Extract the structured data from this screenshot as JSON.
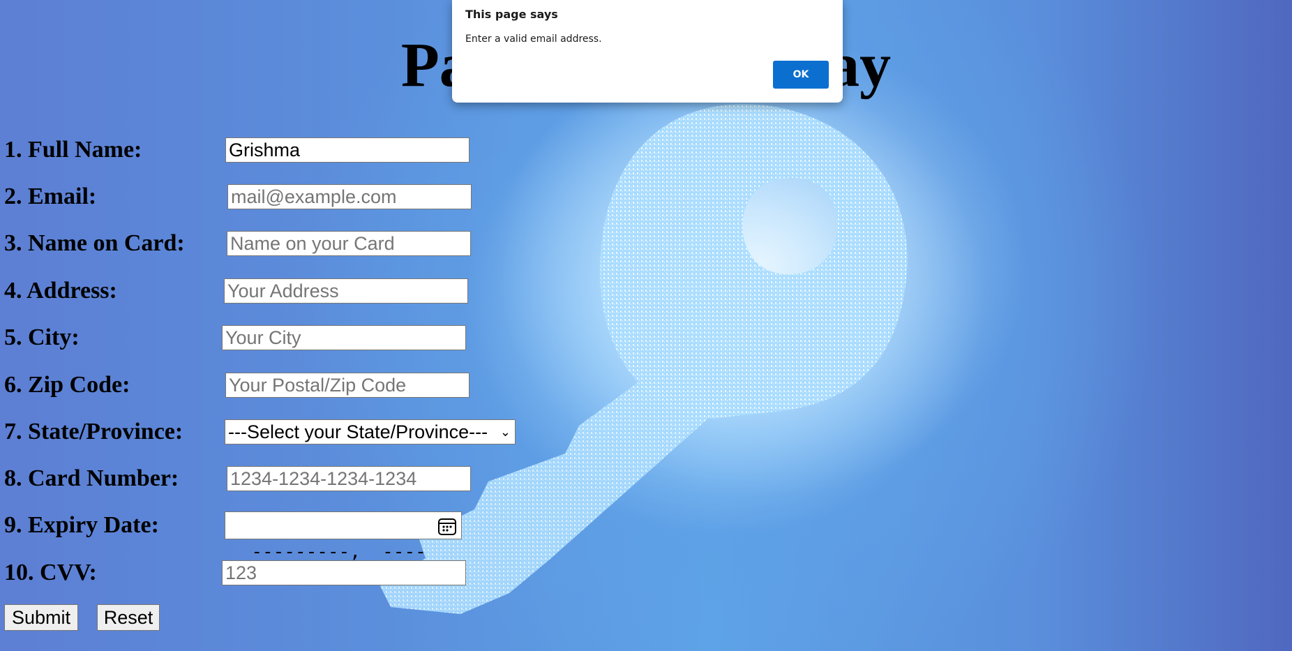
{
  "page": {
    "title": "Payment Gateway"
  },
  "form": {
    "fields": [
      {
        "label": "1. Full Name:",
        "value": "Grishma",
        "placeholder": ""
      },
      {
        "label": "2. Email:",
        "value": "",
        "placeholder": "mail@example.com"
      },
      {
        "label": "3. Name on Card:",
        "value": "",
        "placeholder": "Name on your Card"
      },
      {
        "label": "4. Address:",
        "value": "",
        "placeholder": "Your Address"
      },
      {
        "label": "5. City:",
        "value": "",
        "placeholder": "Your City"
      },
      {
        "label": "6. Zip Code:",
        "value": "",
        "placeholder": "Your Postal/Zip Code"
      },
      {
        "label": "7. State/Province:",
        "value": "---Select your State/Province---"
      },
      {
        "label": "8. Card Number:",
        "value": "",
        "placeholder": "1234-1234-1234-1234"
      },
      {
        "label": "9. Expiry Date:",
        "value": "---------,  ----"
      },
      {
        "label": "10. CVV:",
        "value": "",
        "placeholder": "123"
      }
    ],
    "submit_label": "Submit",
    "reset_label": "Reset"
  },
  "dialog": {
    "title": "This page says",
    "message": "Enter a valid email address.",
    "ok_label": "OK",
    "ok_color": "#0b6fd0"
  }
}
